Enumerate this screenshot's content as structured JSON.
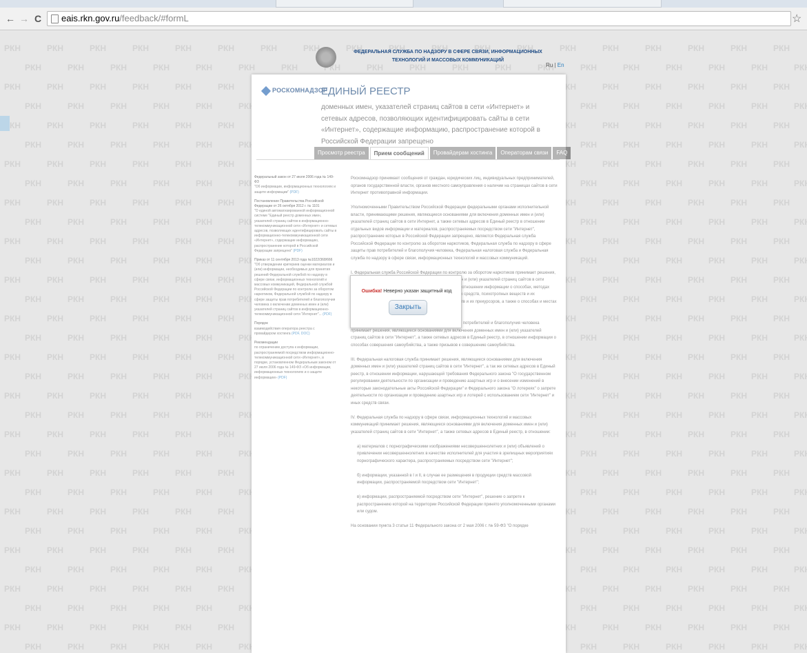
{
  "browser": {
    "url_host": "eais.rkn.gov.ru",
    "url_path": "/feedback/#formL"
  },
  "watermark": "РКН",
  "header": {
    "agency": "ФЕДЕРАЛЬНАЯ СЛУЖБА ПО НАДЗОРУ В СФЕРЕ СВЯЗИ, ИНФОРМАЦИОННЫХ ТЕХНОЛОГИЙ И МАССОВЫХ КОММУНИКАЦИЙ",
    "lang_ru": "Ru",
    "lang_sep": "|",
    "lang_en": "En"
  },
  "logo": "РОСКОМНАДЗОР",
  "registry": {
    "title": "ЕДИНЫЙ РЕЕСТР",
    "subtitle": "доменных имен, указателей страниц сайтов в сети «Интернет» и сетевых адресов, позволяющих идентифицировать сайты в сети «Интернет», содержащие информацию, распространение которой в Российской Федерации запрещено"
  },
  "tabs": [
    {
      "label": "Просмотр реестра",
      "active": false
    },
    {
      "label": "Прием сообщений",
      "active": true
    },
    {
      "label": "Провайдерам хостинга",
      "active": false
    },
    {
      "label": "Операторам связи",
      "active": false
    },
    {
      "label": "FAQ",
      "active": false
    }
  ],
  "sidebar": [
    {
      "title": "Федеральный закон от 27 июля 2006 года № 149-ФЗ",
      "text": "\"Об информации, информационных технологиях и защите информации\"",
      "link": "(PDF)"
    },
    {
      "title": "Постановление Правительства Российской Федерации от 26 октября 2012 г. № 1101",
      "text": "\"О единой автоматизированной информационной системе \"Единый реестр доменных имен, указателей страниц сайтов в информационно-телекоммуникационной сети «Интернет» и сетевых адресов, позволяющих идентифицировать сайты в информационно-телекоммуникационной сети «Интернет», содержащие информацию, распространение которой в Российской Федерации запрещено\"",
      "link": "(PDF)"
    },
    {
      "title": "Приказ от 11 сентября 2013 года №1022/368/666",
      "text": "\"Об утверждении критериев оценки материалов и (или) информации, необходимых для принятия решений Федеральной службой по надзору в сфере связи, информационных технологий и массовых коммуникаций, Федеральной службой Российской Федерации по контролю за оборотом наркотиков, Федеральной службой по надзору в сфере защиты прав потребителей и благополучия человека о включении доменных имен и (или) указателей страниц сайтов в информационно-телекоммуникационной сети \"Интернет\"...",
      "link": "(PDF)"
    },
    {
      "title": "Порядок",
      "text": "взаимодействия оператора реестра с провайдером хостинга",
      "link": "(PDF, DOC)"
    },
    {
      "title": "Рекомендации",
      "text": "по ограничению доступа к информации, распространяемой посредством информационно-телекоммуникационной сети «Интернет», в порядке, установленном Федеральным законом от 27 июля 2006 года № 149-ФЗ «Об информации, информационных технологиях и о защите информации»",
      "link": "(PDF)"
    }
  ],
  "content": [
    "Роскомнадзор принимает сообщения от граждан, юридических лиц, индивидуальных предпринимателей, органов государственной власти, органов местного самоуправления о наличии на страницах сайтов в сети Интернет противоправной информации.",
    "Уполномоченными Правительством Российской Федерации федеральными органами исполнительной власти, принимающими решения, являющиеся основаниями для включения доменных имен и (или) указателей страниц сайтов в сети Интернет, а также сетевых адресов в Единый реестр в отношении отдельных видов информации и материалов, распространяемых посредством сети \"Интернет\", распространение которых в Российской Федерации запрещено, являются Федеральная служба Российской Федерации по контролю за оборотом наркотиков, Федеральная служба по надзору в сфере защиты прав потребителей и благополучия человека, Федеральная налоговая служба и Федеральная служба по надзору в сфере связи, информационных технологий и массовых коммуникаций.",
    "I. Федеральная служба Российской Федерации по контролю за оборотом наркотиков принимает решения, являющиеся основаниями для включения доменных имен и (или) указателей страниц сайтов в сети \"Интернет\", а также сетевых адресов в Единый реестр, в отношении информации о способах, методах разработки, изготовления и использования наркотических средств, психотропных веществ и их прекурсоров, местах приобретения таких средств, веществ и их прекурсоров, а также о способах и местах культивирования наркосодержащих растений.",
    "II. Федеральная служба по надзору в сфере защиты прав потребителей и благополучия человека принимает решения, являющиеся основаниями для включения доменных имен и (или) указателей страниц сайтов в сети \"Интернет\", а также сетевых адресов в Единый реестр, в отношении информации о способах совершения самоубийства, а также призывов к совершению самоубийства.",
    "III. Федеральная налоговая служба принимает решения, являющиеся основаниями для включения доменных имен и (или) указателей страниц сайтов в сети \"Интернет\", а так же сетевых адресов в Единый реестр, в отношении информации, нарушающей требования Федерального закона \"О государственном регулировании деятельности по организации и проведению азартных игр и о внесении изменений в некоторые законодательные акты Российской Федерации\" и Федерального закона \"О лотереях\" о запрете деятельности по организации и проведению азартных игр и лотерей с использованием сети \"Интернет\" и иных средств связи.",
    "IV. Федеральная служба по надзору в сфере связи, информационных технологий и массовых коммуникаций принимает решения, являющиеся основаниями для включения доменных имен и (или) указателей страниц сайтов в сети \"Интернет\", а также сетевых адресов в Единый реестр, в отношении:"
  ],
  "content_items": [
    "а) материалов с порнографическими изображениями несовершеннолетних и (или) объявлений о привлечении несовершеннолетних в качестве исполнителей для участия в зрелищных мероприятиях порнографического характера, распространяемых посредством сети \"Интернет\";",
    "б) информации, указанной в I и II, в случае ее размещения в продукции средств массовой информации, распространяемой посредством сети \"Интернет\";",
    "в) информации, распространяемой посредством сети \"Интернет\", решение о запрете к распространению которой на территории Российской Федерации принято уполномоченными органами или судом."
  ],
  "content_tail": "На основании пункта 3 статьи 11 Федерального закона от 2 мая 2006 г. № 59-ФЗ \"О порядке",
  "dialog": {
    "error_label": "Ошибка!",
    "message": "Неверно указан защитный код",
    "close_label": "Закрыть"
  }
}
